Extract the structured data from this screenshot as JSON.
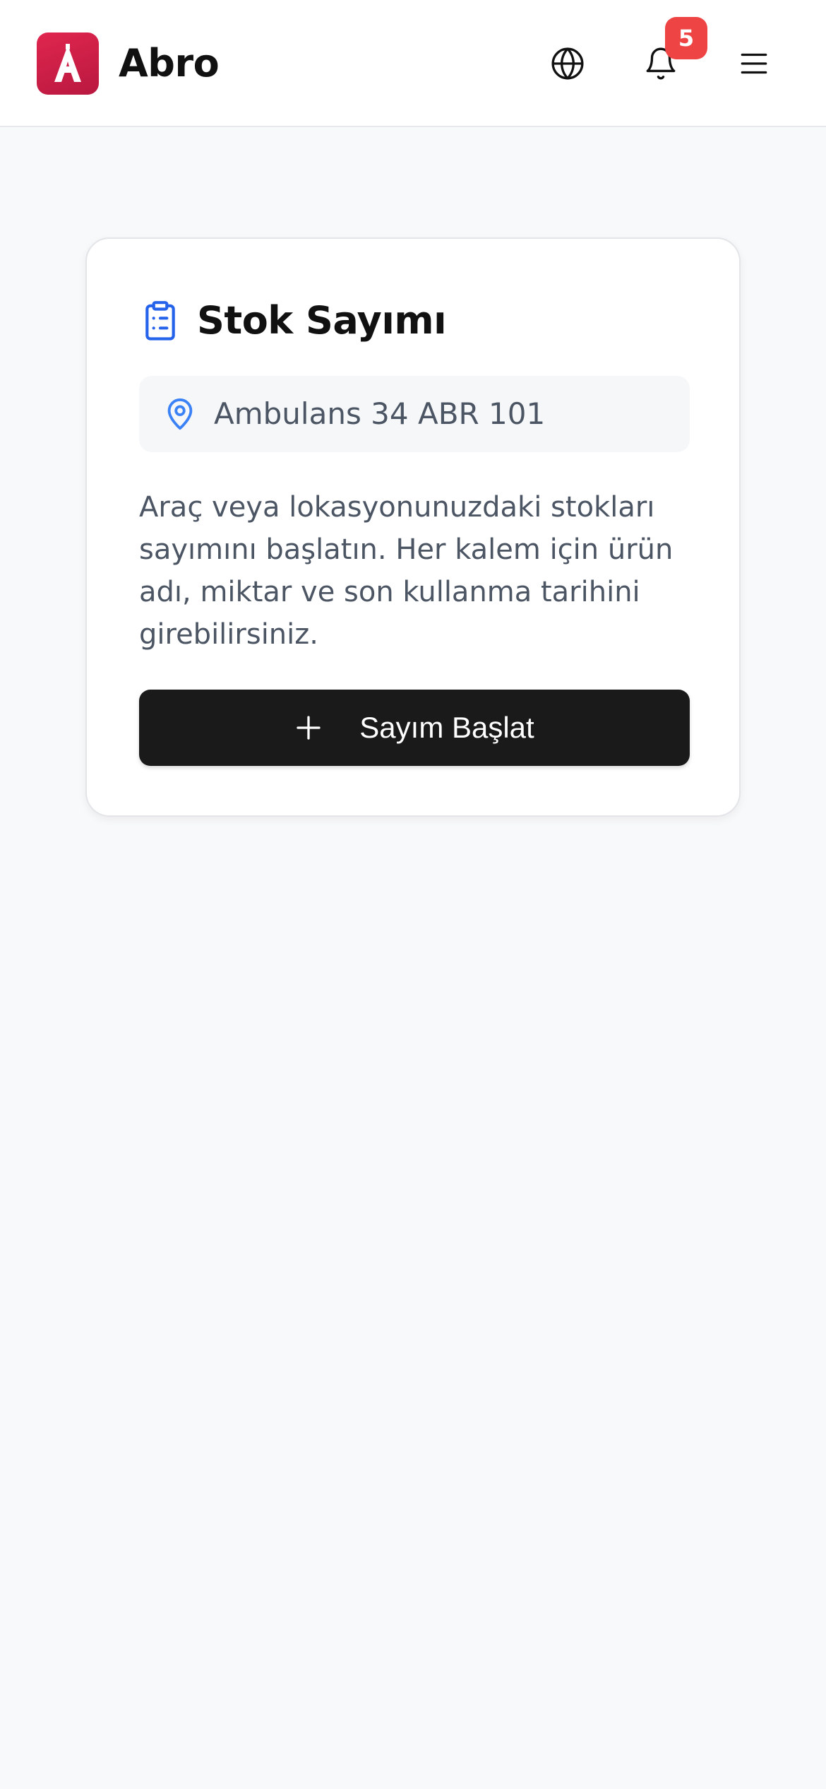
{
  "header": {
    "app_name": "Abro",
    "logo_icon": "abro-logo-icon",
    "notification_count": "5",
    "icons": [
      "globe-icon",
      "bell-icon",
      "menu-icon"
    ],
    "brand_color": "#d11f47"
  },
  "card": {
    "title": "Stok Sayımı",
    "title_icon": "clipboard-list-icon",
    "location": {
      "icon": "map-pin-icon",
      "text": "Ambulans 34 ABR 101"
    },
    "description": "Araç veya lokasyonunuzdaki stokları sayımını başlatın. Her kalem için ürün adı, miktar ve son kullanma tarihini girebilirsiniz.",
    "start_button": {
      "icon": "plus-icon",
      "label": "Sayım Başlat"
    },
    "accent_color": "#2563eb"
  }
}
